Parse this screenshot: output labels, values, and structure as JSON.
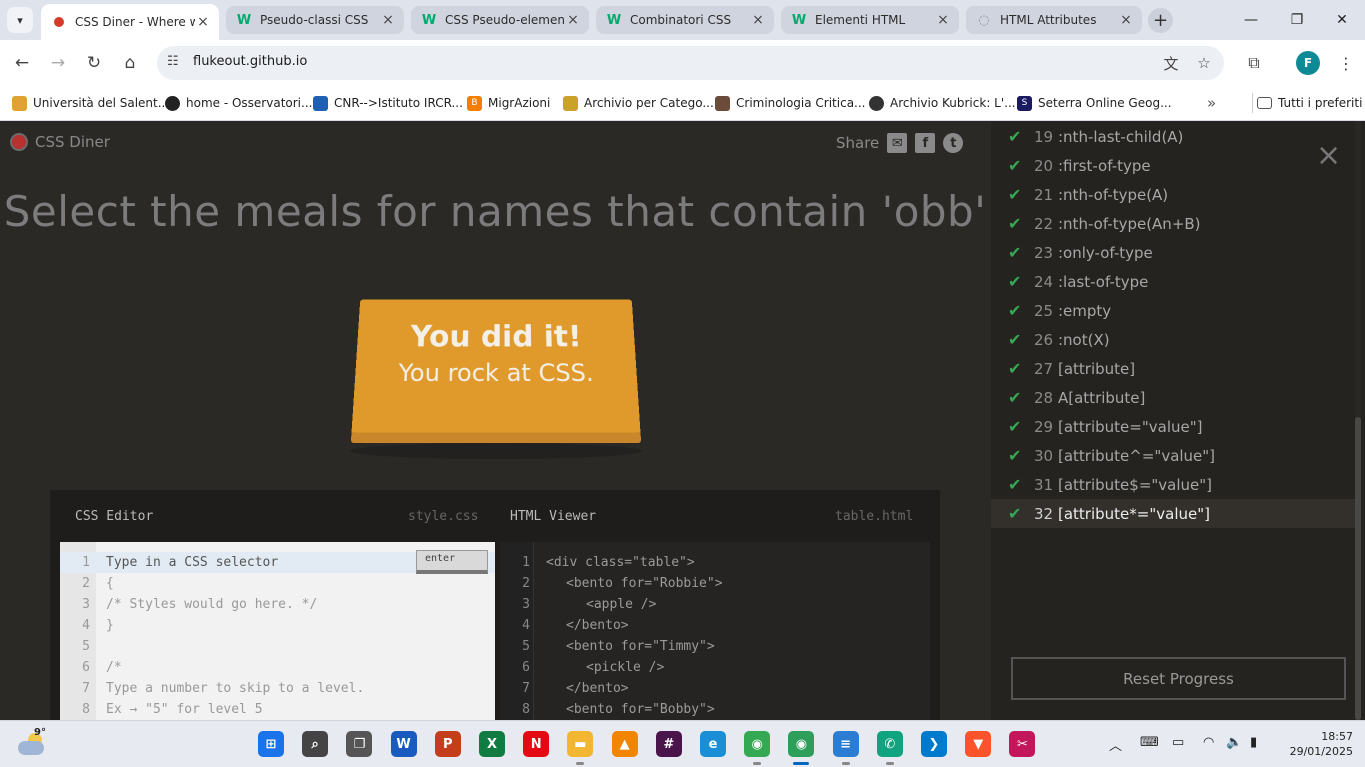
{
  "browser": {
    "tabs": [
      {
        "label": "CSS Diner - Where we",
        "icon": "css-diner-icon",
        "active": true
      },
      {
        "label": "Pseudo-classi CSS",
        "icon": "w3-icon",
        "active": false
      },
      {
        "label": "CSS Pseudo-elements",
        "icon": "w3-icon",
        "active": false
      },
      {
        "label": "Combinatori CSS",
        "icon": "w3-icon",
        "active": false
      },
      {
        "label": "Elementi HTML",
        "icon": "w3-icon",
        "active": false
      },
      {
        "label": "HTML Attributes",
        "icon": "globe-icon",
        "active": false
      }
    ],
    "url": "flukeout.github.io",
    "profile_initial": "F",
    "bookmarks": [
      {
        "label": "Università del Salent...",
        "color": "#e2a233"
      },
      {
        "label": "home - Osservatori...",
        "color": "#222222"
      },
      {
        "label": "CNR-->Istituto IRCR...",
        "color": "#1f5fb4"
      },
      {
        "label": "MigrAzioni",
        "color": "#f57d00"
      },
      {
        "label": "Archivio per Catego...",
        "color": "#c9a227"
      },
      {
        "label": "Criminologia Critica...",
        "color": "#6b4b3a"
      },
      {
        "label": "Archivio Kubrick: L'...",
        "color": "#333333"
      },
      {
        "label": "Seterra Online Geog...",
        "color": "#1a1a60"
      }
    ],
    "bookmarks_all": "Tutti i preferiti"
  },
  "page": {
    "logo": "CSS Diner",
    "share": "Share",
    "heading": "Select the meals for names that contain 'obb'",
    "table_line1": "You did it!",
    "table_line2": "You rock at CSS."
  },
  "css_editor": {
    "title": "CSS Editor",
    "file": "style.css",
    "enter": "enter",
    "lines": [
      "Type in a CSS selector",
      "{",
      "/* Styles would go here. */",
      "}",
      "",
      "/*",
      "Type a number to skip to a level.",
      "Ex → \"5\" for level 5"
    ]
  },
  "html_viewer": {
    "title": "HTML Viewer",
    "file": "table.html",
    "lines": [
      {
        "indent": 0,
        "text": "<div class=\"table\">"
      },
      {
        "indent": 1,
        "text": "<bento for=\"Robbie\">"
      },
      {
        "indent": 2,
        "text": "<apple />"
      },
      {
        "indent": 1,
        "text": "</bento>"
      },
      {
        "indent": 1,
        "text": "<bento for=\"Timmy\">"
      },
      {
        "indent": 2,
        "text": "<pickle />"
      },
      {
        "indent": 1,
        "text": "</bento>"
      },
      {
        "indent": 1,
        "text": "<bento for=\"Bobby\">"
      }
    ]
  },
  "levels": [
    {
      "num": "19",
      "name": ":nth-last-child(A)"
    },
    {
      "num": "20",
      "name": ":first-of-type"
    },
    {
      "num": "21",
      "name": ":nth-of-type(A)"
    },
    {
      "num": "22",
      "name": ":nth-of-type(An+B)"
    },
    {
      "num": "23",
      "name": ":only-of-type"
    },
    {
      "num": "24",
      "name": ":last-of-type"
    },
    {
      "num": "25",
      "name": ":empty"
    },
    {
      "num": "26",
      "name": ":not(X)"
    },
    {
      "num": "27",
      "name": "[attribute]"
    },
    {
      "num": "28",
      "name": "A[attribute]"
    },
    {
      "num": "29",
      "name": "[attribute=\"value\"]"
    },
    {
      "num": "30",
      "name": "[attribute^=\"value\"]"
    },
    {
      "num": "31",
      "name": "[attribute$=\"value\"]"
    },
    {
      "num": "32",
      "name": "[attribute*=\"value\"]"
    }
  ],
  "current_level": "32",
  "reset": "Reset Progress",
  "taskbar": {
    "temperature": "9°",
    "time": "18:57",
    "date": "29/01/2025",
    "apps": [
      {
        "name": "start",
        "label": "",
        "color": "#1a73e8"
      },
      {
        "name": "search",
        "label": "",
        "color": "#444444"
      },
      {
        "name": "task-view",
        "label": "",
        "color": "#555555"
      },
      {
        "name": "word",
        "label": "W",
        "color": "#185abd"
      },
      {
        "name": "powerpoint",
        "label": "P",
        "color": "#c43e1c"
      },
      {
        "name": "excel",
        "label": "X",
        "color": "#107c41"
      },
      {
        "name": "netflix",
        "label": "N",
        "color": "#e50914"
      },
      {
        "name": "file-explorer",
        "label": "",
        "color": "#f2b632"
      },
      {
        "name": "vlc",
        "label": "",
        "color": "#f28500"
      },
      {
        "name": "slack",
        "label": "",
        "color": "#4a154b"
      },
      {
        "name": "edge",
        "label": "",
        "color": "#1b8fd6"
      },
      {
        "name": "chrome",
        "label": "",
        "color": "#34a853"
      },
      {
        "name": "chrome-profile",
        "label": "",
        "color": "#2e9e5b"
      },
      {
        "name": "notepad",
        "label": "",
        "color": "#2b7cd3"
      },
      {
        "name": "whatsapp",
        "label": "",
        "color": "#10a37f"
      },
      {
        "name": "vscode",
        "label": "",
        "color": "#007acc"
      },
      {
        "name": "brave",
        "label": "",
        "color": "#fb542b"
      },
      {
        "name": "snipping-tool",
        "label": "",
        "color": "#c2185b"
      }
    ]
  }
}
